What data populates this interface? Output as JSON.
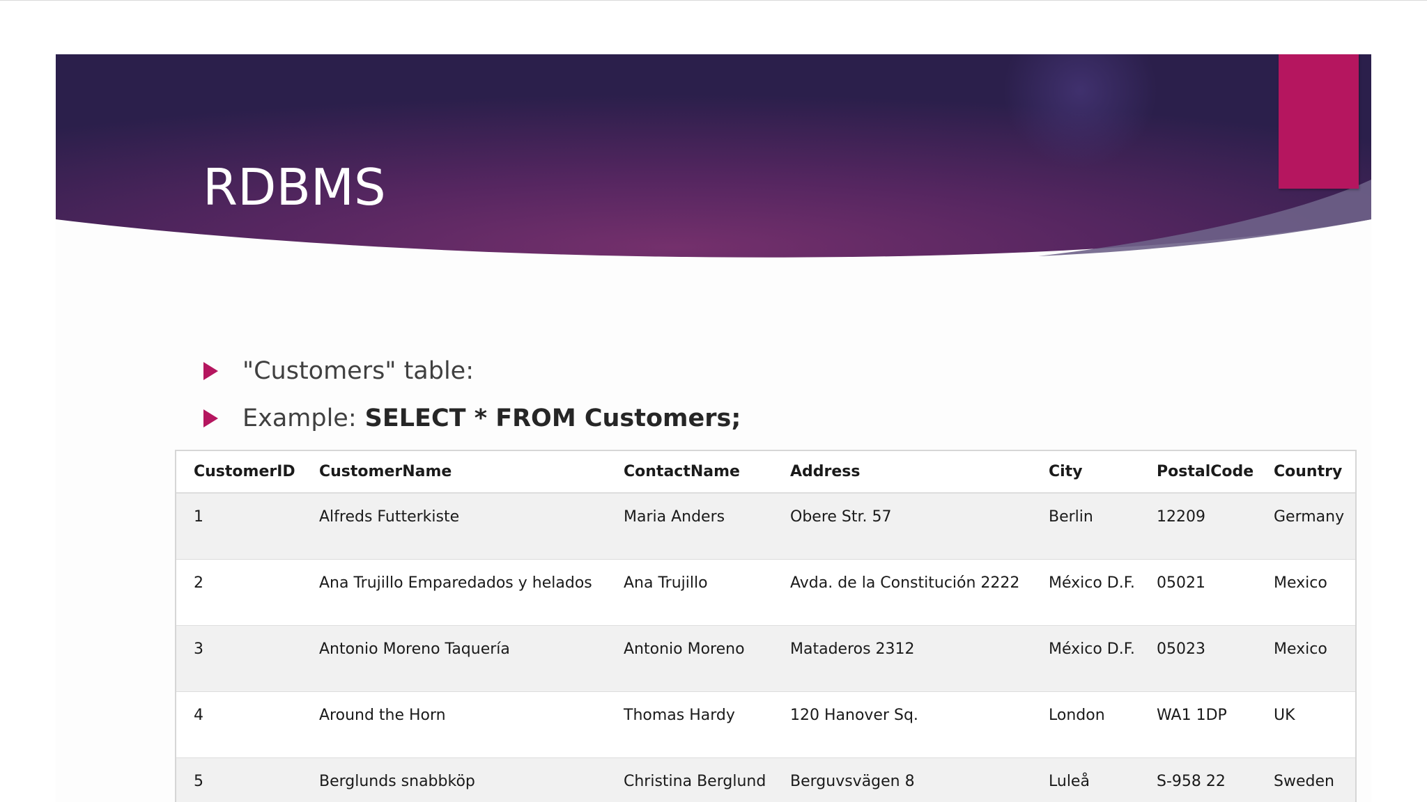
{
  "slide": {
    "title": "RDBMS",
    "bullets": [
      {
        "text": "\"Customers\" table:"
      },
      {
        "text": "Example:",
        "bold": "SELECT * FROM Customers;"
      }
    ]
  },
  "colors": {
    "banner_dark": "#2a1f4a",
    "banner_mid": "#6d2a68",
    "accent_pink": "#b5165f",
    "bullet_arrow": "#b5165f"
  },
  "table": {
    "headers": [
      "CustomerID",
      "CustomerName",
      "ContactName",
      "Address",
      "City",
      "PostalCode",
      "Country"
    ],
    "rows": [
      [
        "1",
        "Alfreds Futterkiste",
        "Maria Anders",
        "Obere Str. 57",
        "Berlin",
        "12209",
        "Germany"
      ],
      [
        "2",
        "Ana Trujillo Emparedados y helados",
        "Ana Trujillo",
        "Avda. de la Constitución 2222",
        "México D.F.",
        "05021",
        "Mexico"
      ],
      [
        "3",
        "Antonio Moreno Taquería",
        "Antonio Moreno",
        "Mataderos 2312",
        "México D.F.",
        "05023",
        "Mexico"
      ],
      [
        "4",
        "Around the Horn",
        "Thomas Hardy",
        "120 Hanover Sq.",
        "London",
        "WA1 1DP",
        "UK"
      ],
      [
        "5",
        "Berglunds snabbköp",
        "Christina Berglund",
        "Berguvsvägen 8",
        "Luleå",
        "S-958 22",
        "Sweden"
      ]
    ]
  }
}
